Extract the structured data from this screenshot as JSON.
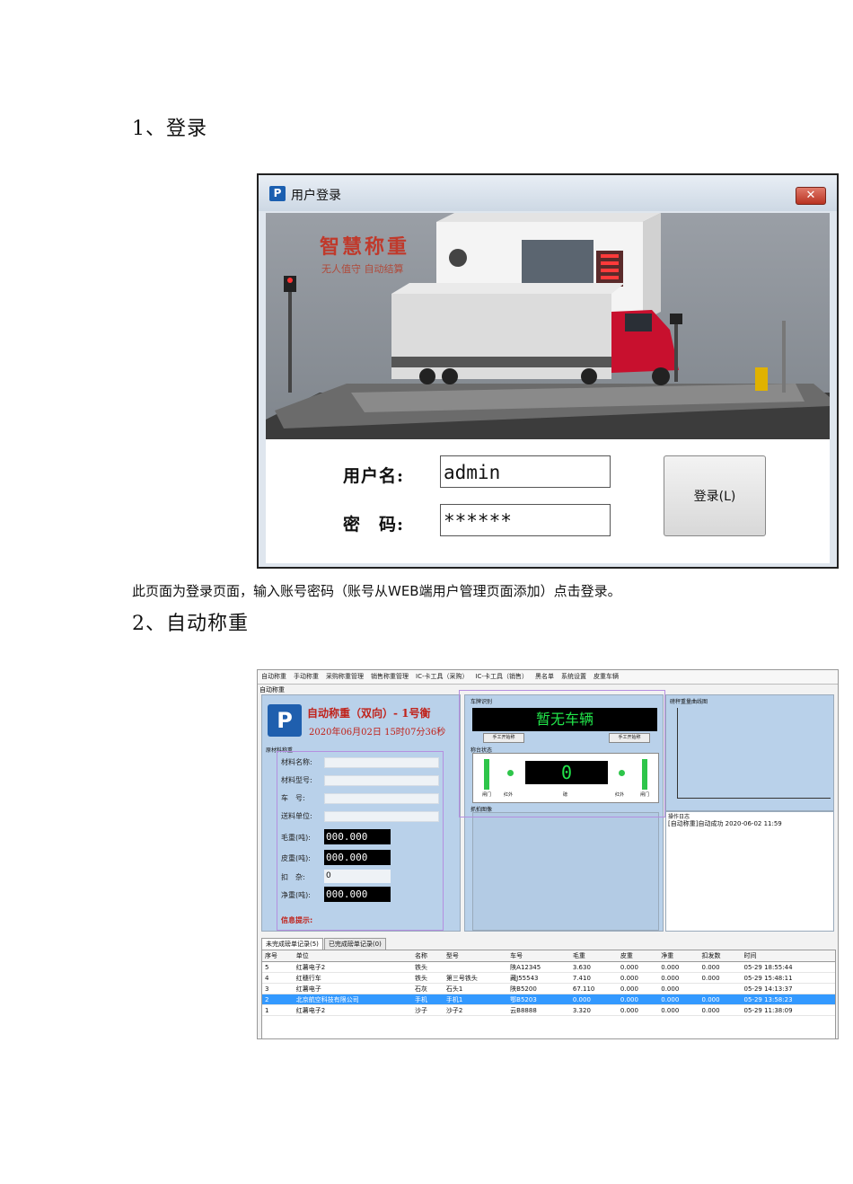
{
  "section1": {
    "heading": "1、登录"
  },
  "login_window": {
    "icon_text": "P",
    "title": "用户登录",
    "close_glyph": "✕",
    "brand_title": "智慧称重",
    "brand_subtitle": "无人值守 自动结算",
    "username_label": "用户名:",
    "password_label": "密　码:",
    "username_value": "admin",
    "password_value": "******",
    "login_button": "登录(L)"
  },
  "caption": "此页面为登录页面，输入账号密码（账号从WEB端用户管理页面添加）点击登录。",
  "section2": {
    "heading": "2、自动称重"
  },
  "weigh_window": {
    "menu": [
      "自动称重",
      "手动称重",
      "采购称重管理",
      "销售称重管理",
      "IC-卡工具（采购）",
      "IC-卡工具（销售）",
      "黑名单",
      "系统设置",
      "皮重车辆"
    ],
    "tab_label": "自动称重",
    "logo_text": "P",
    "title": "自动称重（双向）- 1号衡",
    "datetime": "2020年06月02日 15时07分36秒",
    "material_section": "原材料称重",
    "fields": [
      "材料名称:",
      "材料型号:",
      "车　号:",
      "送料单位:"
    ],
    "gross_label": "毛重(吨):",
    "gross_value": "000.000",
    "tare_label": "皮重(吨):",
    "tare_value": "000.000",
    "deduct_label": "扣　杂:",
    "deduct_value": "0",
    "net_label": "净重(吨):",
    "net_value": "000.000",
    "info_tip": "信息提示:",
    "plate_section": "车牌识别",
    "plate_text": "暂无车辆",
    "manual_in": "手工开始称",
    "manual_out": "手工开始称",
    "scale_section": "称台状态",
    "scale_value": "0",
    "scale_labels": [
      "闸门",
      "红外",
      "磅",
      "红外",
      "闸门"
    ],
    "snapshot_section": "抓拍图像",
    "chart_section": "磅秤重量曲线图",
    "log_section": "操作日志",
    "log_line": "[自动称重]自动成功     2020-06-02 11:59",
    "tabs": [
      "未完成磅单记录(5)",
      "已完成磅单记录(0)"
    ],
    "columns": [
      "序号",
      "单位",
      "名称",
      "型号",
      "车号",
      "毛重",
      "皮重",
      "净重",
      "扣发数",
      "时间"
    ],
    "rows": [
      [
        "5",
        "红薯电子2",
        "铁头",
        "",
        "陕A12345",
        "3.630",
        "0.000",
        "0.000",
        "0.000",
        "05-29 18:55:44"
      ],
      [
        "4",
        "红穗行车",
        "铁头",
        "第三号铁头",
        "藏J55543",
        "7.410",
        "0.000",
        "0.000",
        "0.000",
        "05-29 15:48:11"
      ],
      [
        "3",
        "红薯电子",
        "石灰",
        "石头1",
        "陕B5200",
        "67.110",
        "0.000",
        "0.000",
        "",
        "05-29 14:13:37"
      ],
      [
        "2",
        "北京航空科技有限公司",
        "手机",
        "手机1",
        "鄂B5203",
        "0.000",
        "0.000",
        "0.000",
        "0.000",
        "05-29 13:58:23"
      ],
      [
        "1",
        "红薯电子2",
        "沙子",
        "沙子2",
        "云B8888",
        "3.320",
        "0.000",
        "0.000",
        "0.000",
        "05-29 11:38:09"
      ]
    ]
  }
}
